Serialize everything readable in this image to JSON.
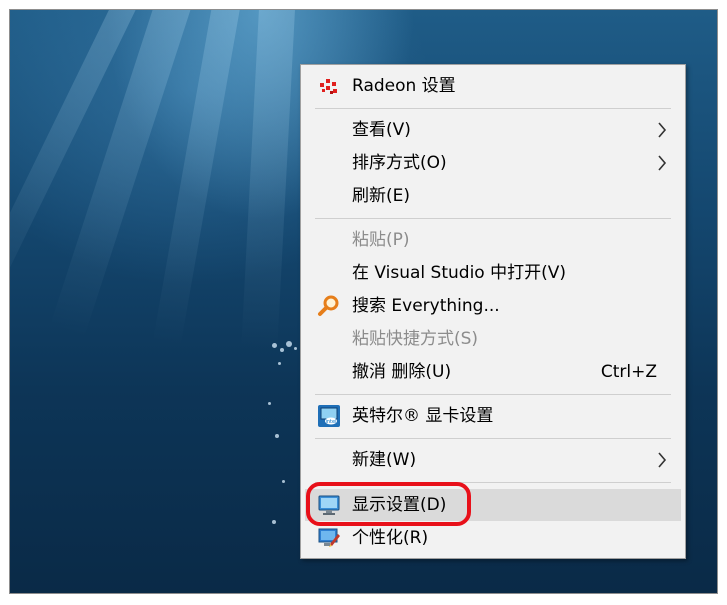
{
  "context_menu": {
    "items": {
      "radeon": {
        "label": "Radeon 设置",
        "icon": "radeon-icon"
      },
      "view": {
        "label": "查看(V)",
        "has_submenu": true
      },
      "sort": {
        "label": "排序方式(O)",
        "has_submenu": true
      },
      "refresh": {
        "label": "刷新(E)"
      },
      "paste": {
        "label": "粘贴(P)",
        "disabled": true
      },
      "open_vs": {
        "label": "在 Visual Studio 中打开(V)"
      },
      "search_everything": {
        "label": "搜索 Everything...",
        "icon": "magnifier-icon"
      },
      "paste_shortcut": {
        "label": "粘贴快捷方式(S)",
        "disabled": true
      },
      "undo_delete": {
        "label": "撤消 删除(U)",
        "shortcut": "Ctrl+Z"
      },
      "intel_graphics": {
        "label": "英特尔® 显卡设置",
        "icon": "intel-graphics-icon"
      },
      "new": {
        "label": "新建(W)",
        "has_submenu": true
      },
      "display": {
        "label": "显示设置(D)",
        "icon": "display-icon",
        "highlighted": true
      },
      "personalize": {
        "label": "个性化(R)",
        "icon": "personalize-icon"
      }
    }
  },
  "colors": {
    "menu_bg": "#f2f2f2",
    "hover_bg": "#dadada",
    "disabled_text": "#8c8c8c",
    "highlight_ring": "#e8101a",
    "radeon_red": "#e0201e",
    "search_orange": "#e67e1a"
  }
}
